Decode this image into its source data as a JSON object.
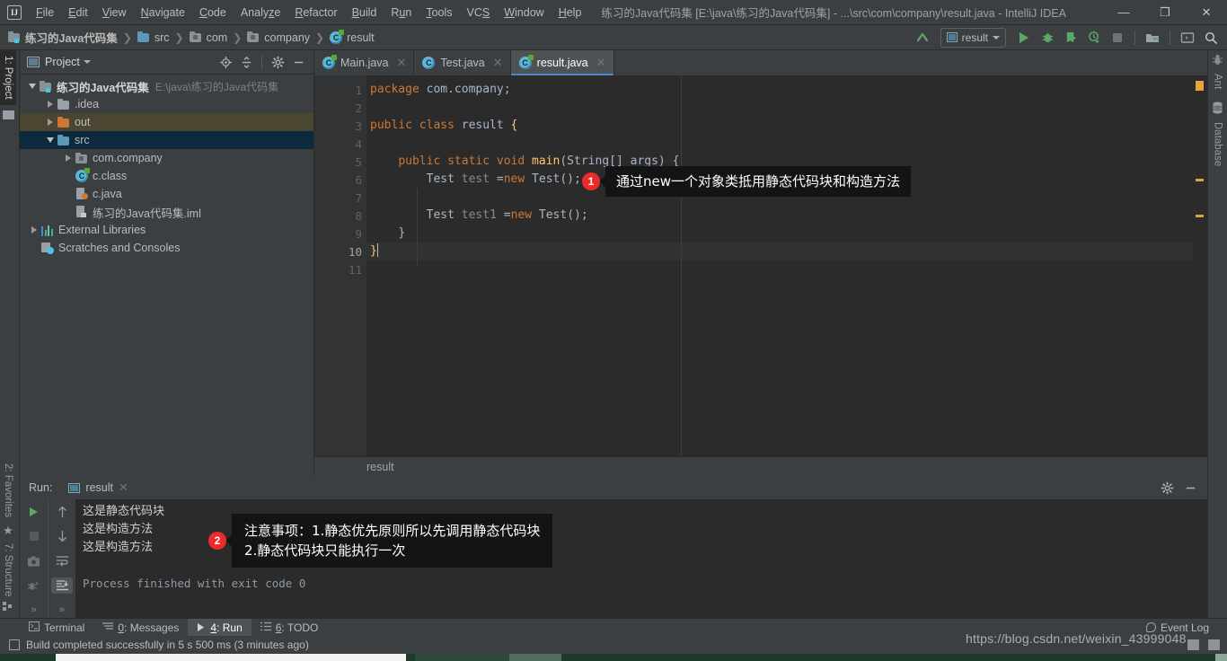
{
  "window": {
    "title": "练习的Java代码集 [E:\\java\\练习的Java代码集] - ...\\src\\com\\company\\result.java - IntelliJ IDEA",
    "logo": "IJ",
    "minimize": "—",
    "maximize": "❐",
    "close": "✕"
  },
  "menubar": {
    "items": [
      {
        "label": "File",
        "mnemonic": "F"
      },
      {
        "label": "Edit",
        "mnemonic": "E"
      },
      {
        "label": "View",
        "mnemonic": "V"
      },
      {
        "label": "Navigate",
        "mnemonic": "N"
      },
      {
        "label": "Code",
        "mnemonic": "C"
      },
      {
        "label": "Analyze",
        "mnemonic": "z"
      },
      {
        "label": "Refactor",
        "mnemonic": "R"
      },
      {
        "label": "Build",
        "mnemonic": "B"
      },
      {
        "label": "Run",
        "mnemonic": "u"
      },
      {
        "label": "Tools",
        "mnemonic": "T"
      },
      {
        "label": "VCS",
        "mnemonic": "S"
      },
      {
        "label": "Window",
        "mnemonic": "W"
      },
      {
        "label": "Help",
        "mnemonic": "H"
      }
    ]
  },
  "navbar": {
    "crumbs": [
      {
        "label": "练习的Java代码集",
        "icon": "project-folder-icon"
      },
      {
        "label": "src",
        "icon": "source-folder-icon"
      },
      {
        "label": "com",
        "icon": "package-folder-icon"
      },
      {
        "label": "company",
        "icon": "package-folder-icon"
      },
      {
        "label": "result",
        "icon": "java-class-icon"
      }
    ],
    "separator": "❯",
    "run_configuration": "result",
    "toolbar_icons": [
      "update-project-icon",
      "run-icon",
      "debug-icon",
      "run-with-coverage-icon",
      "profile-icon",
      "stop-icon",
      "project-structure-icon",
      "open-terminal-icon",
      "search-everywhere-icon"
    ]
  },
  "left_stripe": {
    "top_items": [
      {
        "label": "1: Project",
        "active": true
      }
    ],
    "bottom_items": [
      {
        "label": "2: Favorites",
        "icon": "star-icon"
      },
      {
        "label": "7: Structure",
        "icon": "structure-icon"
      }
    ]
  },
  "right_stripe": {
    "items": [
      {
        "label": "Ant",
        "icon": "ant-icon"
      },
      {
        "label": "Database",
        "icon": "database-icon"
      }
    ]
  },
  "project_panel": {
    "title": "Project",
    "header_icons": [
      "locate-icon",
      "collapse-all-icon",
      "settings-gear-icon",
      "hide-icon"
    ],
    "tree": [
      {
        "label": "练习的Java代码集",
        "sub": "E:\\java\\练习的Java代码集",
        "indent": 0,
        "twisty": "down",
        "icon": "project-folder-icon",
        "bold": true,
        "state": "none"
      },
      {
        "label": ".idea",
        "sub": "",
        "indent": 1,
        "twisty": "right",
        "icon": "folder-icon",
        "bold": false,
        "state": "none"
      },
      {
        "label": "out",
        "sub": "",
        "indent": 1,
        "twisty": "right",
        "icon": "output-folder-icon",
        "bold": false,
        "state": "highlight"
      },
      {
        "label": "src",
        "sub": "",
        "indent": 1,
        "twisty": "down",
        "icon": "source-folder-icon",
        "bold": false,
        "state": "selected"
      },
      {
        "label": "com.company",
        "sub": "",
        "indent": 2,
        "twisty": "right",
        "icon": "package-folder-icon",
        "bold": false,
        "state": "none"
      },
      {
        "label": "c.class",
        "sub": "",
        "indent": 2,
        "twisty": "none",
        "icon": "java-class-icon",
        "bold": false,
        "state": "none"
      },
      {
        "label": "c.java",
        "sub": "",
        "indent": 2,
        "twisty": "none",
        "icon": "java-file-icon",
        "bold": false,
        "state": "none"
      },
      {
        "label": "练习的Java代码集.iml",
        "sub": "",
        "indent": 2,
        "twisty": "none",
        "icon": "iml-file-icon",
        "bold": false,
        "state": "none"
      },
      {
        "label": "External Libraries",
        "sub": "",
        "indent": 0,
        "twisty": "right",
        "icon": "libraries-icon",
        "bold": false,
        "state": "none"
      },
      {
        "label": "Scratches and Consoles",
        "sub": "",
        "indent": 0,
        "twisty": "none",
        "icon": "scratches-icon",
        "bold": false,
        "state": "none"
      }
    ]
  },
  "editor": {
    "tabs": [
      {
        "label": "Main.java",
        "active": false,
        "icon": "java-class-icon"
      },
      {
        "label": "Test.java",
        "active": false,
        "icon": "java-class-icon"
      },
      {
        "label": "result.java",
        "active": true,
        "icon": "java-class-icon"
      }
    ],
    "close_glyph": "✕",
    "line_numbers": [
      "1",
      "2",
      "3",
      "4",
      "5",
      "6",
      "7",
      "8",
      "9",
      "10",
      "11"
    ],
    "current_line": 10,
    "breadcrumb": "result",
    "code_lines": [
      "package com.company;",
      "",
      "public class result {",
      "",
      "    public static void main(String[] args) {",
      "        Test test =new Test();",
      "",
      "        Test test1 =new Test();",
      "    }",
      "}",
      ""
    ]
  },
  "run_panel": {
    "label": "Run:",
    "tab": "result",
    "close_glyph": "✕",
    "gear_icon": "settings-gear-icon",
    "hide_icon": "hide-icon",
    "toolbar_icons_col1": [
      "rerun-icon",
      "stop-icon",
      "screenshot-icon",
      "dump-threads-icon",
      "expand-icon"
    ],
    "toolbar_icons_col2": [
      "up-icon",
      "down-icon",
      "soft-wrap-icon",
      "scroll-to-end-icon",
      "expand-icon"
    ],
    "console_lines": [
      {
        "text": "这是静态代码块",
        "style": "cn"
      },
      {
        "text": "这是构造方法",
        "style": "cn"
      },
      {
        "text": "这是构造方法",
        "style": "cn"
      },
      {
        "text": "",
        "style": "mono"
      },
      {
        "text": "Process finished with exit code 0",
        "style": "grey"
      }
    ]
  },
  "bottom_stripe": {
    "items": [
      {
        "label": "Terminal",
        "mnemonic": "",
        "icon": "terminal-icon",
        "active": false
      },
      {
        "label": "0: Messages",
        "mnemonic": "0",
        "icon": "messages-icon",
        "active": false
      },
      {
        "label": "4: Run",
        "mnemonic": "4",
        "icon": "run-icon",
        "active": true
      },
      {
        "label": "6: TODO",
        "mnemonic": "6",
        "icon": "todo-icon",
        "active": false
      }
    ],
    "event_log": "Event Log"
  },
  "statusbar": {
    "message": "Build completed successfully in 5 s 500 ms (3 minutes ago)",
    "icon": "build-icon"
  },
  "watermark": {
    "text": "https://blog.csdn.net/weixin_43999048"
  },
  "callouts": [
    {
      "id": 1,
      "number": "1",
      "text": "通过new一个对象类抵用静态代码块和构造方法"
    },
    {
      "id": 2,
      "number": "2",
      "text": "注意事项：1.静态优先原则所以先调用静态代码块\n2.静态代码块只能执行一次"
    }
  ],
  "colors": {
    "accent_blue": "#4a88c7",
    "selection": "#0d293e",
    "keyword_orange": "#cc7832",
    "method_yellow": "#ffc66d",
    "text_grey": "#a9b7c6",
    "badge_red": "#ee2b2b",
    "run_green": "#59a869"
  }
}
